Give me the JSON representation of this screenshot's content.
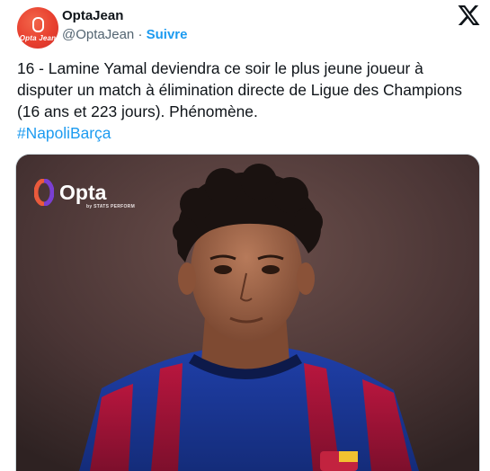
{
  "author": {
    "name": "OptaJean",
    "handle": "@OptaJean",
    "separator": "·",
    "follow_label": "Suivre",
    "avatar_text": "Opta Jean"
  },
  "tweet": {
    "text": "16 - Lamine Yamal deviendra ce soir le plus jeune joueur à disputer un match à élimination directe de Ligue des Champions (16 ans et 223 jours). Phénomène.",
    "hashtag": "#NapoliBarça"
  },
  "media": {
    "logo_text": "Opta",
    "logo_subtext": "by STATS PERFORM",
    "description": "Lamine Yamal portrait in FC Barcelona kit"
  },
  "colors": {
    "accent": "#1d9bf0",
    "text": "#0f1419",
    "muted": "#536471",
    "avatar": "#e8402f"
  },
  "icons": {
    "platform": "x-logo-icon",
    "opta": "opta-logo-icon"
  }
}
